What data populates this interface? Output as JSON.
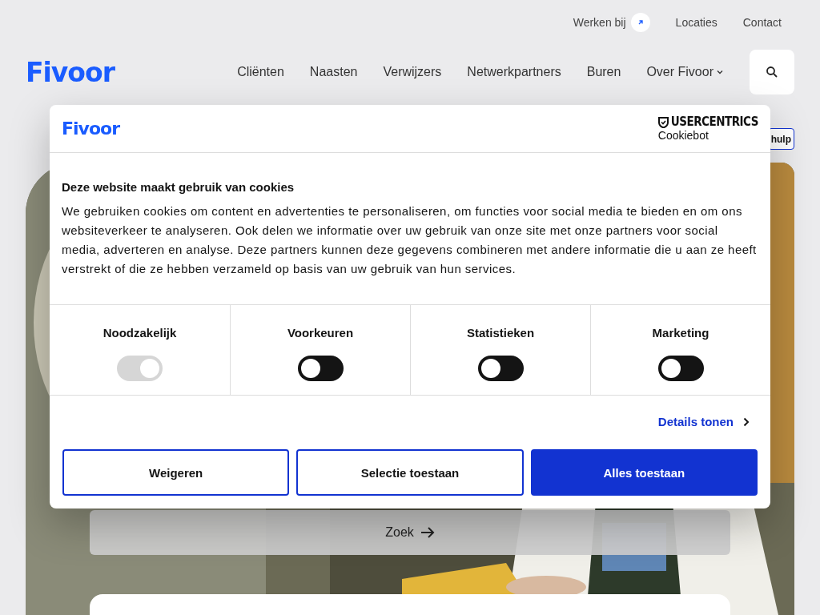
{
  "top_links": [
    {
      "label": "Werken bij",
      "external": true
    },
    {
      "label": "Locaties",
      "external": false
    },
    {
      "label": "Contact",
      "external": false
    }
  ],
  "header": {
    "logo": "Fivoor",
    "nav": [
      {
        "label": "Cliënten",
        "dropdown": false
      },
      {
        "label": "Naasten",
        "dropdown": false
      },
      {
        "label": "Verwijzers",
        "dropdown": false
      },
      {
        "label": "Netwerkpartners",
        "dropdown": false
      },
      {
        "label": "Buren",
        "dropdown": false
      },
      {
        "label": "Over Fivoor",
        "dropdown": true
      }
    ]
  },
  "help_button": "hulp",
  "hero": {
    "kind": "picture",
    "search_button": "Zoek"
  },
  "cookie_dialog": {
    "logo": "Fivoor",
    "provider": "USERCENTRICS",
    "provider_sub": "Cookiebot",
    "title": "Deze website maakt gebruik van cookies",
    "text": "We gebruiken cookies om content en advertenties te personaliseren, om functies voor social media te bieden en om ons websiteverkeer te analyseren. Ook delen we informatie over uw gebruik van onze site met onze partners voor social media, adverteren en analyse. Deze partners kunnen deze gegevens combineren met andere informatie die u aan ze heeft verstrekt of die ze hebben verzameld op basis van uw gebruik van hun services.",
    "categories": [
      {
        "label": "Noodzakelijk",
        "checked": true,
        "disabled": true
      },
      {
        "label": "Voorkeuren",
        "checked": false,
        "disabled": false
      },
      {
        "label": "Statistieken",
        "checked": false,
        "disabled": false
      },
      {
        "label": "Marketing",
        "checked": false,
        "disabled": false
      }
    ],
    "details_link": "Details tonen",
    "buttons": [
      {
        "label": "Weigeren",
        "kind": "outline"
      },
      {
        "label": "Selectie toestaan",
        "kind": "outline"
      },
      {
        "label": "Alles toestaan",
        "kind": "primary"
      }
    ]
  }
}
